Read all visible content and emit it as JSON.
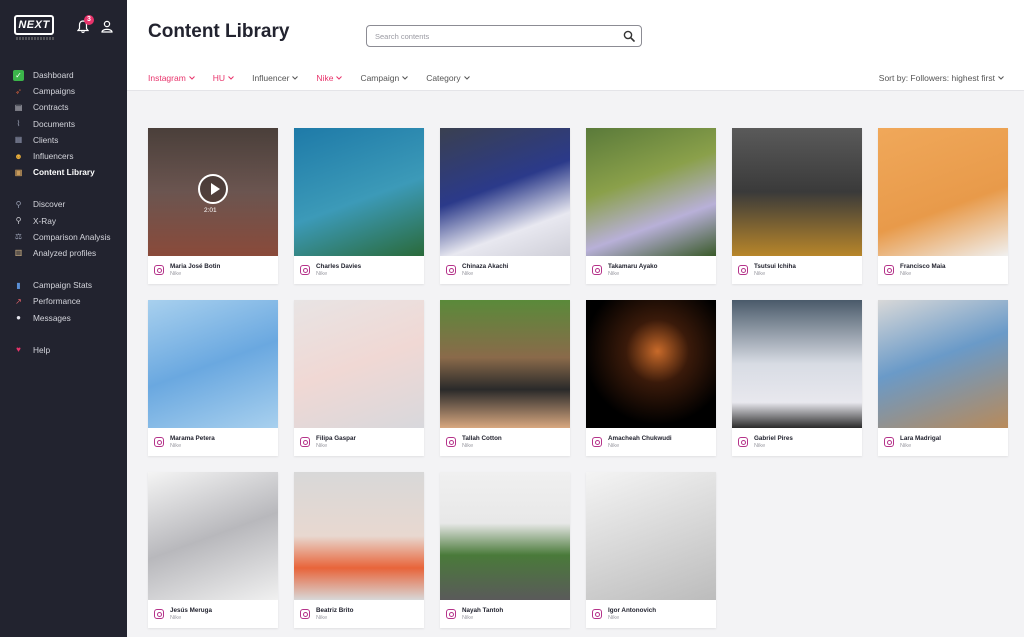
{
  "app": {
    "logo_text": "NEXT",
    "notification_count": "3"
  },
  "sidebar": {
    "groups": [
      [
        {
          "label": "Dashboard",
          "icon": "check-icon",
          "color": "#3bb54a",
          "glyph": "✓"
        },
        {
          "label": "Campaigns",
          "icon": "rocket-icon",
          "color": "#c45a3a",
          "glyph": "➶"
        },
        {
          "label": "Contracts",
          "icon": "document-icon",
          "color": "#cfcfd6",
          "glyph": "▤"
        },
        {
          "label": "Documents",
          "icon": "paperclip-icon",
          "color": "#9aa0b4",
          "glyph": "⌇"
        },
        {
          "label": "Clients",
          "icon": "building-icon",
          "color": "#8a90a8",
          "glyph": "▦"
        },
        {
          "label": "Influencers",
          "icon": "smiley-icon",
          "color": "#f0b23a",
          "glyph": "☻"
        },
        {
          "label": "Content Library",
          "icon": "box-icon",
          "color": "#c89a5a",
          "glyph": "▣",
          "active": true
        }
      ],
      [
        {
          "label": "Discover",
          "icon": "telescope-icon",
          "color": "#9aa0b4",
          "glyph": "⚲"
        },
        {
          "label": "X-Ray",
          "icon": "magnifier-icon",
          "color": "#cfcfd6",
          "glyph": "⚲"
        },
        {
          "label": "Comparison Analysis",
          "icon": "scale-icon",
          "color": "#9aa0b4",
          "glyph": "⚖"
        },
        {
          "label": "Analyzed profiles",
          "icon": "clipboard-icon",
          "color": "#d6b98a",
          "glyph": "▥"
        }
      ],
      [
        {
          "label": "Campaign Stats",
          "icon": "bar-chart-icon",
          "color": "#5a8fd6",
          "glyph": "▮"
        },
        {
          "label": "Performance",
          "icon": "trend-chart-icon",
          "color": "#e8636b",
          "glyph": "↗"
        },
        {
          "label": "Messages",
          "icon": "speech-bubble-icon",
          "color": "#e6e6ee",
          "glyph": "●"
        }
      ],
      [
        {
          "label": "Help",
          "icon": "heart-icon",
          "color": "#e8336b",
          "glyph": "♥"
        }
      ]
    ]
  },
  "header": {
    "title": "Content Library",
    "search_placeholder": "Search contents",
    "filters": [
      {
        "label": "Instagram",
        "active": true
      },
      {
        "label": "HU",
        "active": true
      },
      {
        "label": "Influencer",
        "active": false
      },
      {
        "label": "Nike",
        "active": true
      },
      {
        "label": "Campaign",
        "active": false
      },
      {
        "label": "Category",
        "active": false
      }
    ],
    "sort_label": "Sort by: Followers: highest first"
  },
  "cards": [
    {
      "name": "Maria José Botin",
      "brand": "Nike",
      "video": true,
      "duration": "2:01",
      "bg": "linear-gradient(180deg,#4a3f3a 0%,#6b5550 50%,#8a4a3a 100%)"
    },
    {
      "name": "Charles Davies",
      "brand": "Nike",
      "bg": "linear-gradient(160deg,#1e7aa8 0%,#3c9ab8 55%,#2a6a3a 100%)"
    },
    {
      "name": "Chinaza Akachi",
      "brand": "Nike",
      "bg": "linear-gradient(160deg,#3a4050 0%,#2b3a8a 45%,#e8e8f0 75%,#cfcfd8 100%)"
    },
    {
      "name": "Takamaru Ayako",
      "brand": "Nike",
      "bg": "linear-gradient(160deg,#5a7a3a 0%,#8aa04a 40%,#b8b0d8 70%,#3a5a2a 100%)"
    },
    {
      "name": "Tsutsui Ichiha",
      "brand": "Nike",
      "bg": "linear-gradient(180deg,#5a5a5a 0%,#3a3a3a 50%,#b8862a 100%)"
    },
    {
      "name": "Francisco Maia",
      "brand": "Nike",
      "bg": "linear-gradient(160deg,#f0a85a 0%,#e89a4a 60%,#f0f0f0 100%)"
    },
    {
      "name": "Marama Petera",
      "brand": "Nike",
      "bg": "linear-gradient(160deg,#a8d0ee 0%,#6aa8e0 50%,#a8d0ee 100%)"
    },
    {
      "name": "Filipa Gaspar",
      "brand": "Nike",
      "bg": "linear-gradient(160deg,#e8e4e4 0%,#f0d8d4 50%,#d8d8dc 100%)"
    },
    {
      "name": "Tallah Cotton",
      "brand": "Nike",
      "bg": "linear-gradient(180deg,#5a8a3a 0%,#8a6a4a 45%,#2a2a2a 70%,#d8a880 100%)"
    },
    {
      "name": "Amacheah Chukwudi",
      "brand": "Nike",
      "bg": "radial-gradient(circle at 55% 40%,#c86a2a 0%,#3a1a0a 30%,#000000 70%)"
    },
    {
      "name": "Gabriel Pires",
      "brand": "Nike",
      "bg": "linear-gradient(180deg,#4a5a6a 0%,#d8dce4 50%,#e8e8ee 80%,#2a2a2a 100%)"
    },
    {
      "name": "Lara Madrigal",
      "brand": "Nike",
      "bg": "linear-gradient(160deg,#d8d8d8 0%,#6a9ac8 45%,#b88a5a 100%)"
    },
    {
      "name": "Jesús Meruga",
      "brand": "Nike",
      "bg": "linear-gradient(160deg,#f4f4f4 0%,#b8b8bc 50%,#f0f0f0 100%)"
    },
    {
      "name": "Beatriz Brito",
      "brand": "Nike",
      "bg": "linear-gradient(180deg,#d8d8d8 0%,#e8d8d0 50%,#e8643a 75%,#d8d8d8 100%)"
    },
    {
      "name": "Nayah Tantoh",
      "brand": "Nike",
      "bg": "linear-gradient(180deg,#f0f0f0 0%,#e8e8e8 40%,#4a7a3a 65%,#5a5a5a 100%)"
    },
    {
      "name": "Igor Antonovich",
      "brand": "Nike",
      "bg": "linear-gradient(160deg,#f4f4f4 0%,#d8d8d8 50%,#bcbcbc 100%)"
    }
  ]
}
